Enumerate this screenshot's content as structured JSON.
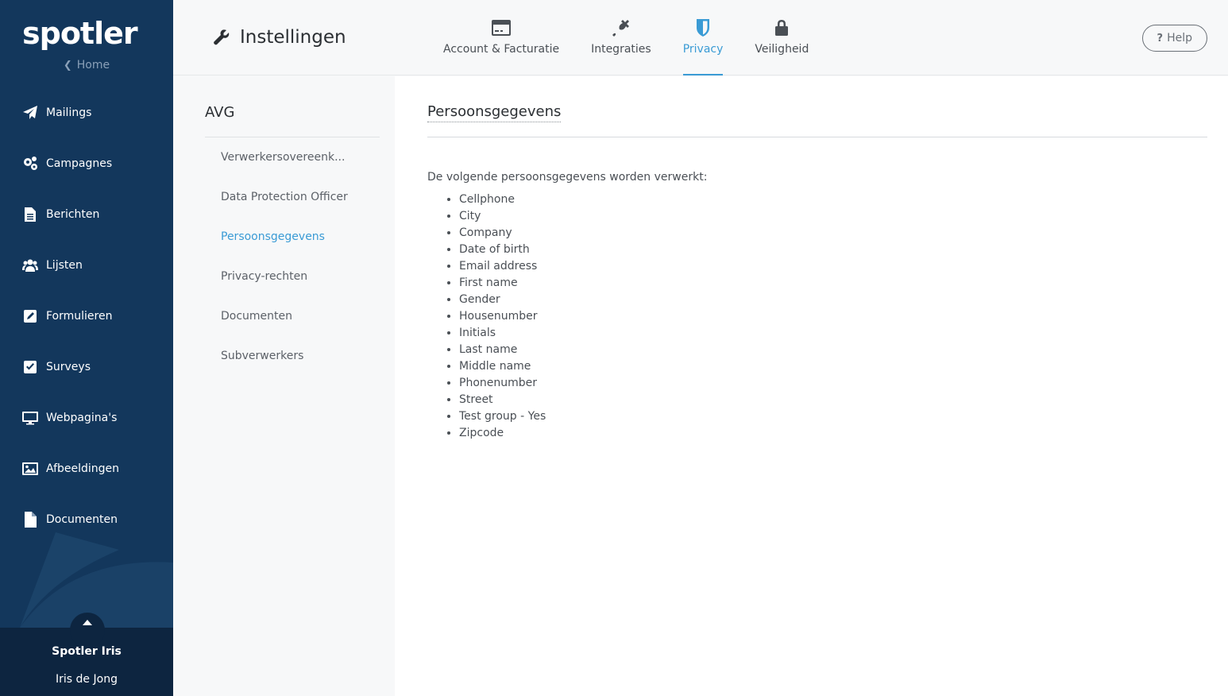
{
  "sidebar": {
    "logo": "spotler",
    "home_label": "Home",
    "items": [
      {
        "label": "Mailings",
        "icon": "paper-plane-icon"
      },
      {
        "label": "Campagnes",
        "icon": "gears-icon"
      },
      {
        "label": "Berichten",
        "icon": "document-text-icon"
      },
      {
        "label": "Lijsten",
        "icon": "users-icon"
      },
      {
        "label": "Formulieren",
        "icon": "edit-icon"
      },
      {
        "label": "Surveys",
        "icon": "checkbox-icon"
      },
      {
        "label": "Webpagina's",
        "icon": "monitor-icon"
      },
      {
        "label": "Afbeeldingen",
        "icon": "image-icon"
      },
      {
        "label": "Documenten",
        "icon": "file-icon"
      }
    ],
    "user": {
      "company": "Spotler Iris",
      "name": "Iris de Jong"
    }
  },
  "header": {
    "title": "Instellingen",
    "tabs": [
      {
        "label": "Account & Facturatie",
        "icon": "credit-card-icon"
      },
      {
        "label": "Integraties",
        "icon": "plug-icon"
      },
      {
        "label": "Privacy",
        "icon": "shield-icon"
      },
      {
        "label": "Veiligheid",
        "icon": "lock-icon"
      }
    ],
    "help_label": "Help"
  },
  "subnav": {
    "title": "AVG",
    "items": [
      "Verwerkersovereenk...",
      "Data Protection Officer",
      "Persoonsgegevens",
      "Privacy-rechten",
      "Documenten",
      "Subverwerkers"
    ]
  },
  "main": {
    "title": "Persoonsgegevens",
    "intro": "De volgende persoonsgegevens worden verwerkt:",
    "fields": [
      "Cellphone",
      "City",
      "Company",
      "Date of birth",
      "Email address",
      "First name",
      "Gender",
      "Housenumber",
      "Initials",
      "Last name",
      "Middle name",
      "Phonenumber",
      "Street",
      "Test group - Yes",
      "Zipcode"
    ]
  },
  "colors": {
    "sidebar_bg": "#13375c",
    "accent": "#3a9bd5"
  }
}
